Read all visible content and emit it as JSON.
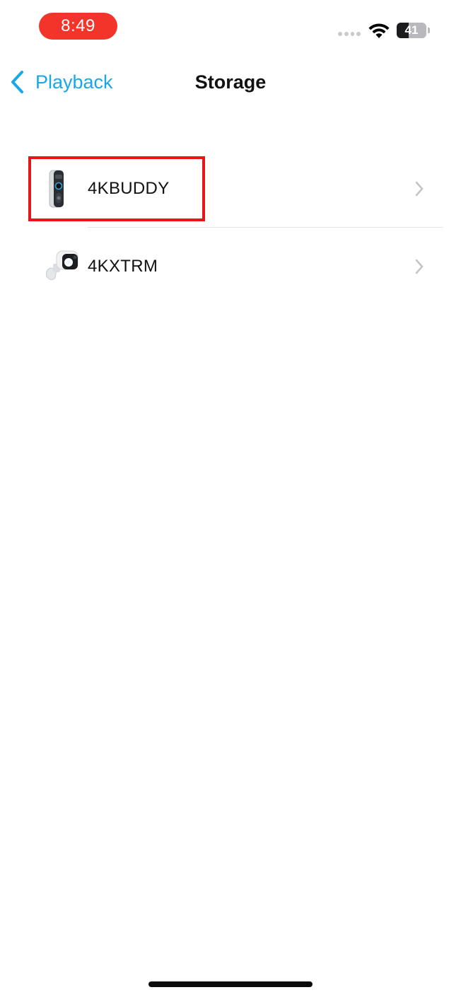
{
  "status_bar": {
    "time": "8:49",
    "battery_level": "41",
    "battery_fraction": 0.41,
    "time_pill_color": "#f2342a",
    "icons": [
      "cellular-dots-icon",
      "wifi-icon",
      "battery-icon"
    ]
  },
  "nav": {
    "back_label": "Playback",
    "title": "Storage",
    "accent_color": "#1aa7e6"
  },
  "devices": [
    {
      "name": "4KBUDDY",
      "thumbnail": "doorbell-camera-icon",
      "highlighted": true
    },
    {
      "name": "4KXTRM",
      "thumbnail": "spotlight-camera-icon",
      "highlighted": false
    }
  ],
  "highlight_color": "#e6141b"
}
